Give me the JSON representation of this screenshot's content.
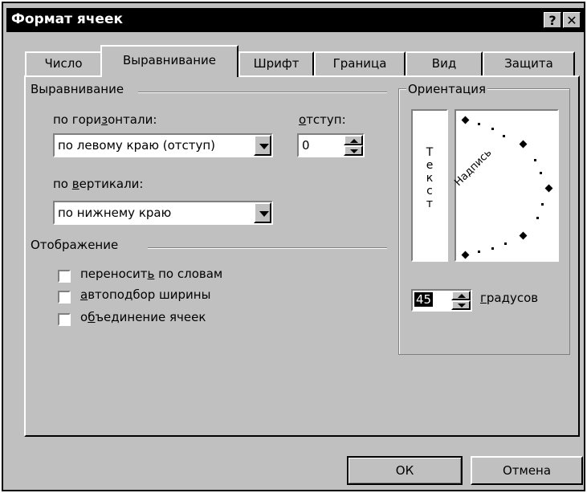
{
  "dialog": {
    "title": "Формат ячеек",
    "help_glyph": "?",
    "close_glyph": "✕"
  },
  "tabs": [
    {
      "label": "Число",
      "active": false
    },
    {
      "label": "Выравнивание",
      "active": true
    },
    {
      "label": "Шрифт",
      "active": false
    },
    {
      "label": "Граница",
      "active": false
    },
    {
      "label": "Вид",
      "active": false
    },
    {
      "label": "Защита",
      "active": false
    }
  ],
  "alignment": {
    "group_label": "Выравнивание",
    "horizontal_label": "по горизонтали:",
    "horizontal_value": "по левому краю (отступ)",
    "indent_label": "отступ:",
    "indent_value": "0",
    "vertical_label": "по вертикали:",
    "vertical_value": "по нижнему краю"
  },
  "display": {
    "group_label": "Отображение",
    "wrap_text": {
      "label": "переносить по словам",
      "checked": false
    },
    "shrink_to_fit": {
      "label": "автоподбор ширины",
      "checked": false
    },
    "merge_cells": {
      "label": "объединение ячеек",
      "checked": false
    }
  },
  "orientation": {
    "group_label": "Ориентация",
    "vertical_text": [
      "Т",
      "е",
      "к",
      "с",
      "т"
    ],
    "dial_text": "Надпись",
    "degrees_value": "45",
    "degrees_label": "градусов"
  },
  "buttons": {
    "ok": "ОК",
    "cancel": "Отмена"
  },
  "icons": {
    "dropdown": "chevron-down-icon",
    "spinner": "spinner-icon",
    "checkbox": "checkbox-icon"
  }
}
